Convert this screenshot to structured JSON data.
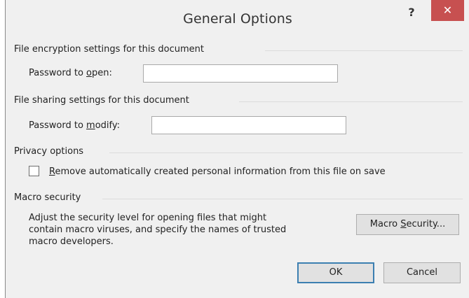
{
  "dialog": {
    "title": "General Options",
    "help_glyph": "?",
    "close_glyph": "✕"
  },
  "encryption": {
    "heading": "File encryption settings for this document",
    "label_pre": "Password to ",
    "label_key": "o",
    "label_post": "pen:",
    "value": ""
  },
  "sharing": {
    "heading": "File sharing settings for this document",
    "label_pre": "Password to ",
    "label_key": "m",
    "label_post": "odify:",
    "value": ""
  },
  "privacy": {
    "heading": "Privacy options",
    "checkbox_key": "R",
    "checkbox_rest": "emove automatically created personal information from this file on save",
    "checked": false
  },
  "macro": {
    "heading": "Macro security",
    "desc_line1": "Adjust the security level for opening files that might",
    "desc_line2": "contain macro viruses, and specify the names of trusted",
    "desc_line3": "macro developers.",
    "button_pre": "Macro ",
    "button_key": "S",
    "button_post": "ecurity..."
  },
  "footer": {
    "ok_label": "OK",
    "cancel_label": "Cancel"
  }
}
